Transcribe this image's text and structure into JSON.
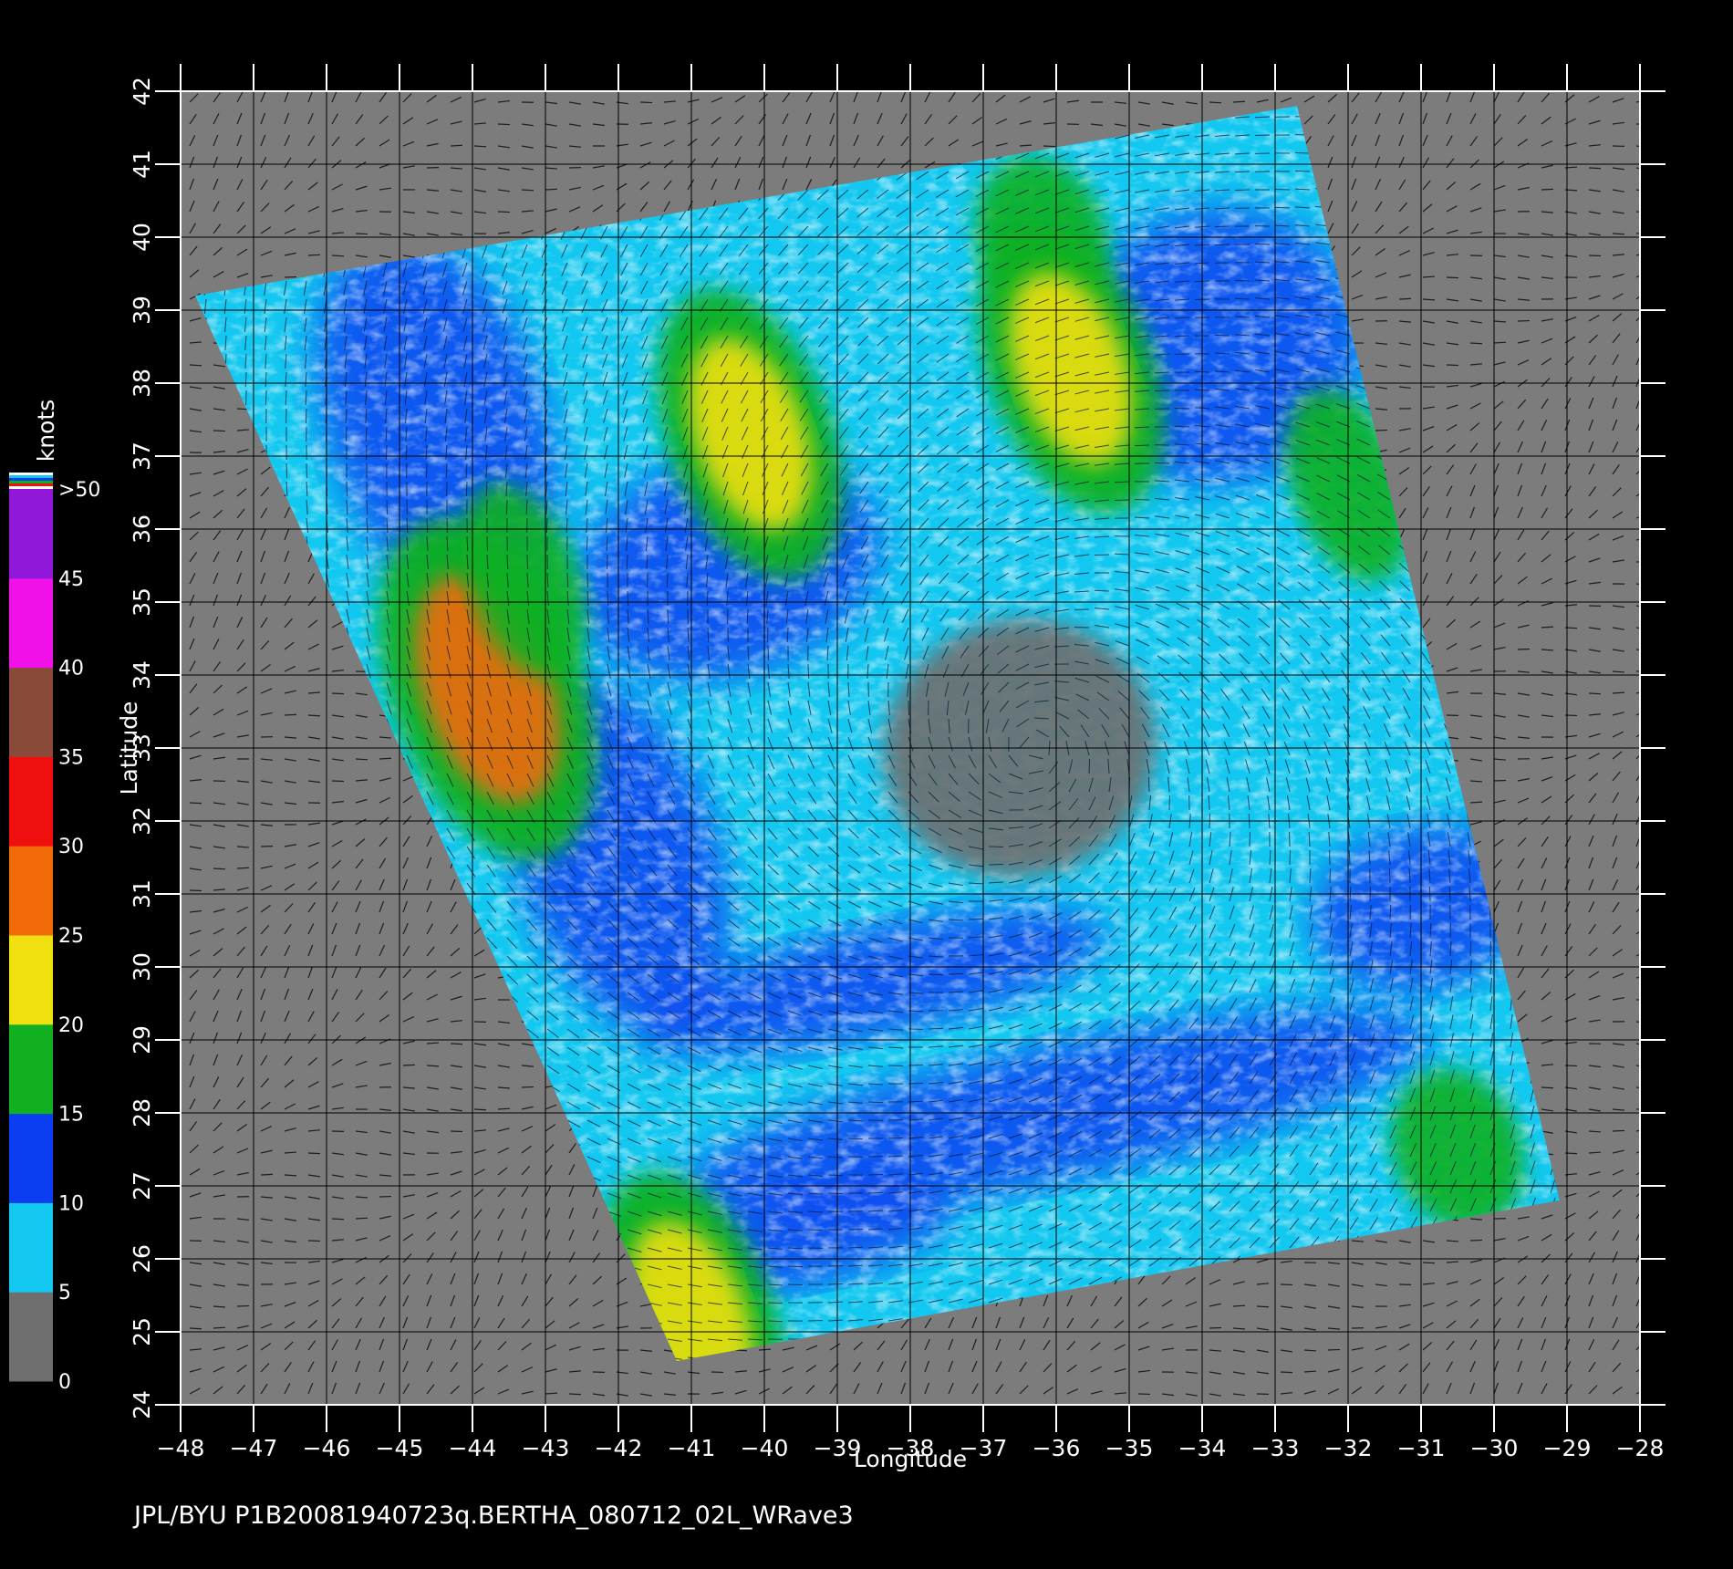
{
  "chart_data": {
    "type": "heatmap",
    "xlabel": "Longitude",
    "ylabel": "Latitude",
    "xlim": [
      -48,
      -28
    ],
    "ylim": [
      24,
      42
    ],
    "x_ticks": [
      "-48",
      "-47",
      "-46",
      "-45",
      "-44",
      "-43",
      "-42",
      "-41",
      "-40",
      "-39",
      "-38",
      "-37",
      "-36",
      "-35",
      "-34",
      "-33",
      "-32",
      "-31",
      "-30",
      "-29",
      "-28"
    ],
    "y_ticks": [
      "24",
      "25",
      "26",
      "27",
      "28",
      "29",
      "30",
      "31",
      "32",
      "33",
      "34",
      "35",
      "36",
      "37",
      "38",
      "39",
      "40",
      "41",
      "42"
    ],
    "grid": true,
    "swath_corners_lonlat": [
      [
        -47.8,
        39.2
      ],
      [
        -32.7,
        41.8
      ],
      [
        -29.1,
        26.8
      ],
      [
        -41.2,
        24.6
      ]
    ],
    "colorbar": {
      "label": "knots",
      "tick_labels": [
        "0",
        "5",
        "10",
        "15",
        "20",
        "25",
        "30",
        "35",
        "40",
        "45",
        ">50"
      ],
      "bins": [
        {
          "from": 0,
          "to": 5,
          "color": "#6e6e6e"
        },
        {
          "from": 5,
          "to": 10,
          "color": "#12c8f0"
        },
        {
          "from": 10,
          "to": 15,
          "color": "#0a3ef0"
        },
        {
          "from": 15,
          "to": 20,
          "color": "#10b020"
        },
        {
          "from": 20,
          "to": 25,
          "color": "#f0e010"
        },
        {
          "from": 25,
          "to": 30,
          "color": "#f06a08"
        },
        {
          "from": 30,
          "to": 35,
          "color": "#f01010"
        },
        {
          "from": 35,
          "to": 40,
          "color": "#8a4a3a"
        },
        {
          "from": 40,
          "to": 45,
          "color": "#f010e8"
        },
        {
          "from": 45,
          "to": 50,
          "color": "#9018d8"
        }
      ]
    },
    "wind_regions": [
      {
        "lon": -43.8,
        "lat": 33.8,
        "speed": 28
      },
      {
        "lon": -43.3,
        "lat": 35.3,
        "speed": 18
      },
      {
        "lon": -41.0,
        "lat": 25.2,
        "speed": 20
      },
      {
        "lon": -40.2,
        "lat": 37.3,
        "speed": 20
      },
      {
        "lon": -36.2,
        "lat": 40.0,
        "speed": 17
      },
      {
        "lon": -35.8,
        "lat": 38.2,
        "speed": 22
      },
      {
        "lon": -32.0,
        "lat": 36.6,
        "speed": 19
      },
      {
        "lon": -30.5,
        "lat": 27.5,
        "speed": 16
      },
      {
        "lon": -36.5,
        "lat": 33.0,
        "speed": 3
      }
    ]
  },
  "footer_text": "JPL/BYU  P1B20081940723q.BERTHA_080712_02L_WRave3"
}
